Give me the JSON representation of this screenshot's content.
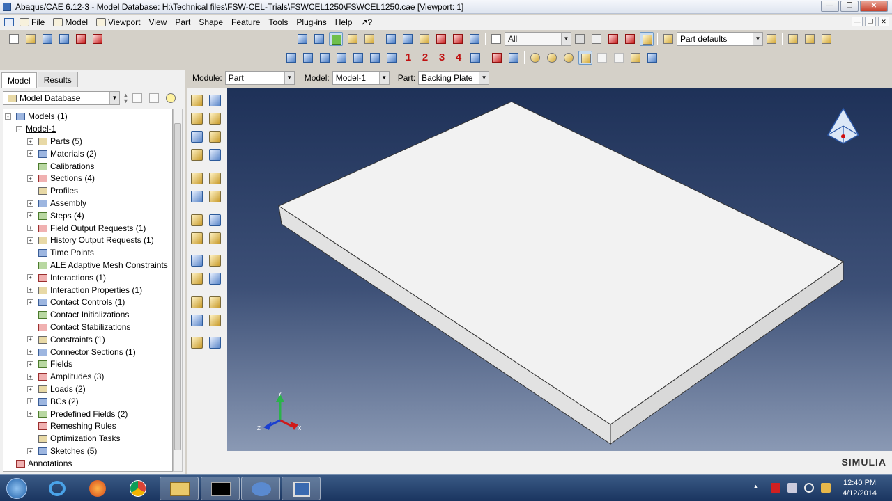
{
  "window": {
    "title": "Abaqus/CAE 6.12-3 - Model Database: H:\\Technical files\\FSW-CEL-Trials\\FSWCEL1250\\FSWCEL1250.cae [Viewport: 1]"
  },
  "menubar": {
    "items": [
      "File",
      "Model",
      "Viewport",
      "View",
      "Part",
      "Shape",
      "Feature",
      "Tools",
      "Plug-ins",
      "Help",
      "↗?"
    ]
  },
  "toolbar": {
    "select_filter": "All",
    "render_defaults": "Part defaults",
    "numbers": [
      "1",
      "2",
      "3",
      "4"
    ]
  },
  "context": {
    "module_label": "Module:",
    "module_value": "Part",
    "model_label": "Model:",
    "model_value": "Model-1",
    "part_label": "Part:",
    "part_value": "Backing Plate"
  },
  "panel": {
    "tabs": [
      "Model",
      "Results"
    ],
    "db_select": "Model Database"
  },
  "tree": {
    "root": "Models (1)",
    "model": "Model-1",
    "items": [
      {
        "label": "Parts (5)",
        "exp": true
      },
      {
        "label": "Materials (2)",
        "exp": true
      },
      {
        "label": "Calibrations",
        "exp": false
      },
      {
        "label": "Sections (4)",
        "exp": true
      },
      {
        "label": "Profiles",
        "exp": false
      },
      {
        "label": "Assembly",
        "exp": true
      },
      {
        "label": "Steps (4)",
        "exp": true
      },
      {
        "label": "Field Output Requests (1)",
        "exp": true
      },
      {
        "label": "History Output Requests (1)",
        "exp": true
      },
      {
        "label": "Time Points",
        "exp": false
      },
      {
        "label": "ALE Adaptive Mesh Constraints",
        "exp": false
      },
      {
        "label": "Interactions (1)",
        "exp": true
      },
      {
        "label": "Interaction Properties (1)",
        "exp": true
      },
      {
        "label": "Contact Controls (1)",
        "exp": true
      },
      {
        "label": "Contact Initializations",
        "exp": false
      },
      {
        "label": "Contact Stabilizations",
        "exp": false
      },
      {
        "label": "Constraints (1)",
        "exp": true
      },
      {
        "label": "Connector Sections (1)",
        "exp": true
      },
      {
        "label": "Fields",
        "exp": true
      },
      {
        "label": "Amplitudes (3)",
        "exp": true
      },
      {
        "label": "Loads (2)",
        "exp": true
      },
      {
        "label": "BCs (2)",
        "exp": true
      },
      {
        "label": "Predefined Fields (2)",
        "exp": true
      },
      {
        "label": "Remeshing Rules",
        "exp": false
      },
      {
        "label": "Optimization Tasks",
        "exp": false
      },
      {
        "label": "Sketches (5)",
        "exp": true
      }
    ],
    "annotations": "Annotations"
  },
  "triad": {
    "x": "X",
    "y": "Y",
    "z": "Z"
  },
  "branding": "SIMULIA",
  "clock": {
    "time": "12:40 PM",
    "date": "4/12/2014"
  },
  "colors": {
    "viewport_top": "#1e3158",
    "viewport_bottom": "#8a99b4",
    "plate_face": "#f2f2f2",
    "plate_side": "#d9d9d9"
  }
}
